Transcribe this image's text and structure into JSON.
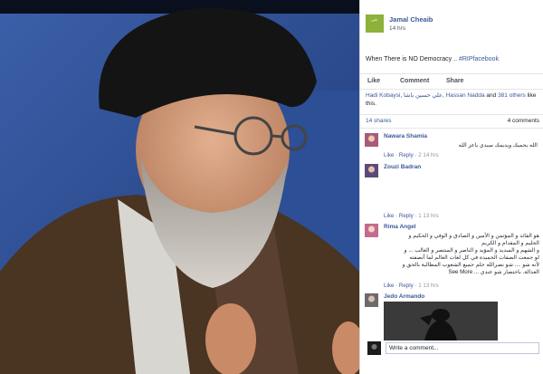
{
  "post": {
    "author": "Jamal Cheaib",
    "time": "14 hrs",
    "text_prefix": "When There is NO Democracy ..",
    "hashtag": "#RIPfacebook",
    "logo_text": "ناس"
  },
  "actions": {
    "like": "Like",
    "comment": "Comment",
    "share": "Share"
  },
  "likes": {
    "name1": "Hadi Kobaysi",
    "name2": "علي حسين باشا",
    "name3": "Hassan Nadda",
    "and_word": "and",
    "others": "381 others",
    "suffix": "like this."
  },
  "counts": {
    "shares": "14 shares",
    "comments": "4 comments"
  },
  "comments": [
    {
      "name": "Nawara Shamia",
      "text": "الله يحميك ويديمك سيدي ياعز الله",
      "like": "Like",
      "reply": "Reply",
      "count": "2",
      "time": "14 hrs"
    },
    {
      "name": "Zouzi Badran",
      "like": "Like",
      "reply": "Reply",
      "count": "1",
      "time": "13 hrs"
    },
    {
      "name": "Rima Angel",
      "lines": [
        "هو القائد و المؤتمن و الأمين و الصادق و الوفي و الحكيم و",
        "الحليم و المقدام و الكريم",
        "و الشهم و السديد و المؤيد و الناصر و المنتصر و الغالب ... و",
        "لو جمعت الصفات الحميدة في كل لغات العالم لما أنصفته",
        "لأنه شو .... شو نصرالله حلم جميع الشعوب المطالبة بالحق و",
        "العدالة. باختصار شو عندي ... See More"
      ],
      "like": "Like",
      "reply": "Reply",
      "count": "1",
      "time": "13 hrs"
    },
    {
      "name": "Jedo Armando"
    }
  ],
  "reply_placeholder": "Write a comment..."
}
